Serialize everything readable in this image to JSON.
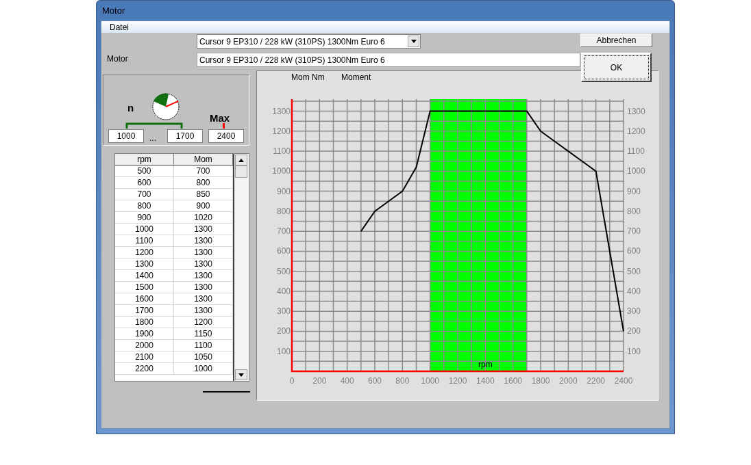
{
  "window": {
    "title": "Motor"
  },
  "menu": [
    {
      "label": "Datei"
    }
  ],
  "engine_select": {
    "value": "Cursor 9 EP310 / 228 kW (310PS) 1300Nm Euro 6"
  },
  "motor_field": {
    "label": "Motor",
    "value": "Cursor 9 EP310 / 228 kW (310PS) 1300Nm Euro 6"
  },
  "buttons": [
    {
      "label": "Abbrechen",
      "default": false
    },
    {
      "label": "OK",
      "default": true
    }
  ],
  "speed_range": {
    "n_label": "n",
    "from": "1000",
    "separator": "...",
    "to": "1700",
    "max_label": "Max",
    "max": "2400"
  },
  "table": {
    "columns": [
      "rpm",
      "Mom"
    ],
    "rows": [
      [
        "500",
        "700"
      ],
      [
        "600",
        "800"
      ],
      [
        "700",
        "850"
      ],
      [
        "800",
        "900"
      ],
      [
        "900",
        "1020"
      ],
      [
        "1000",
        "1300"
      ],
      [
        "1100",
        "1300"
      ],
      [
        "1200",
        "1300"
      ],
      [
        "1300",
        "1300"
      ],
      [
        "1400",
        "1300"
      ],
      [
        "1500",
        "1300"
      ],
      [
        "1600",
        "1300"
      ],
      [
        "1700",
        "1300"
      ],
      [
        "1800",
        "1200"
      ],
      [
        "1900",
        "1150"
      ],
      [
        "2000",
        "1100"
      ],
      [
        "2100",
        "1050"
      ],
      [
        "2200",
        "1000"
      ]
    ]
  },
  "chart": {
    "right_axis_labels": [
      "1300",
      "1200",
      "1100",
      "1000",
      "900",
      "800",
      "700",
      "600",
      "500",
      "400",
      "300",
      "200",
      "100"
    ],
    "chart_data": {
      "type": "line",
      "ylabel": "Mom Nm",
      "xlabel": "rpm",
      "xlim": [
        0,
        2400
      ],
      "ylim": [
        0,
        1360
      ],
      "grid": true,
      "bands": [
        {
          "axis": "x",
          "from": 1000,
          "to": 1700,
          "color": "#00ff00"
        }
      ],
      "xticks": [
        0,
        200,
        400,
        600,
        800,
        1000,
        1200,
        1400,
        1600,
        1800,
        2000,
        2200,
        2400
      ],
      "yticks": [
        100,
        200,
        300,
        400,
        500,
        600,
        700,
        800,
        900,
        1000,
        1100,
        1200,
        1300
      ],
      "series": [
        {
          "name": "Moment",
          "color": "#000000",
          "x": [
            500,
            600,
            700,
            800,
            900,
            1000,
            1100,
            1200,
            1300,
            1400,
            1500,
            1600,
            1700,
            1800,
            1900,
            2000,
            2100,
            2200,
            2400
          ],
          "values": [
            700,
            800,
            850,
            900,
            1020,
            1300,
            1300,
            1300,
            1300,
            1300,
            1300,
            1300,
            1300,
            1200,
            1150,
            1100,
            1050,
            1000,
            200
          ]
        }
      ]
    }
  }
}
